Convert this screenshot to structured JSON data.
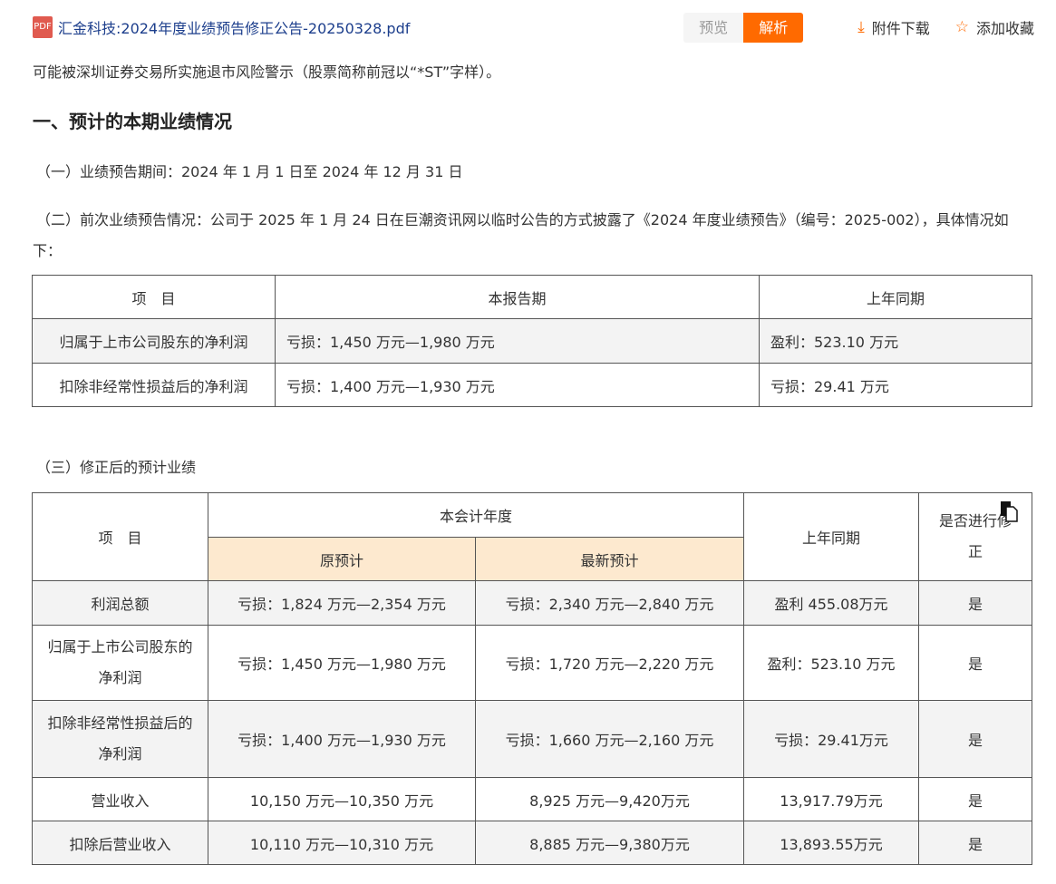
{
  "header": {
    "file_name": "汇金科技:2024年度业绩预告修正公告-20250328.pdf",
    "preview": "预览",
    "analyze": "解析",
    "download": "附件下载",
    "favorite": "添加收藏"
  },
  "intro": "可能被深圳证券交易所实施退市风险警示（股票简称前冠以“*ST”字样）。",
  "heading": "一、预计的本期业绩情况",
  "p1": "（一）业绩预告期间：2024 年 1 月 1 日至 2024 年 12 月 31 日",
  "p2": "（二）前次业绩预告情况：公司于 2025 年 1 月 24 日在巨潮资讯网以临时公告的方式披露了《2024 年度业绩预告》（编号：2025-002），具体情况如下：",
  "table1": {
    "headers": [
      "项　目",
      "本报告期",
      "上年同期"
    ],
    "rows": [
      [
        "归属于上市公司股东的净利润",
        "亏损：1,450 万元—1,980 万元",
        "盈利：523.10 万元"
      ],
      [
        "扣除非经常性损益后的净利润",
        "亏损：1,400 万元—1,930 万元",
        "亏损：29.41 万元"
      ]
    ]
  },
  "p3": "（三）修正后的预计业绩",
  "table2": {
    "h_item": "项　目",
    "h_year": "本会计年度",
    "h_orig": "原预计",
    "h_new": "最新预计",
    "h_prev": "上年同期",
    "h_rev": "是否进行修正",
    "rows": [
      [
        "利润总额",
        "亏损：1,824 万元—2,354 万元",
        "亏损：2,340 万元—2,840 万元",
        "盈利 455.08万元",
        "是"
      ],
      [
        "归属于上市公司股东的净利润",
        "亏损：1,450 万元—1,980 万元",
        "亏损：1,720 万元—2,220 万元",
        "盈利：523.10 万元",
        "是"
      ],
      [
        "扣除非经常性损益后的净利润",
        "亏损：1,400 万元—1,930 万元",
        "亏损：1,660 万元—2,160 万元",
        "亏损：29.41万元",
        "是"
      ],
      [
        "营业收入",
        "10,150 万元—10,350 万元",
        "8,925 万元—9,420万元",
        "13,917.79万元",
        "是"
      ],
      [
        "扣除后营业收入",
        "10,110 万元—10,310 万元",
        "8,885 万元—9,380万元",
        "13,893.55万元",
        "是"
      ]
    ]
  },
  "colors": {
    "accent": "#ff6a00",
    "link": "#1c3e8c",
    "highlight": "#fde9cf"
  }
}
